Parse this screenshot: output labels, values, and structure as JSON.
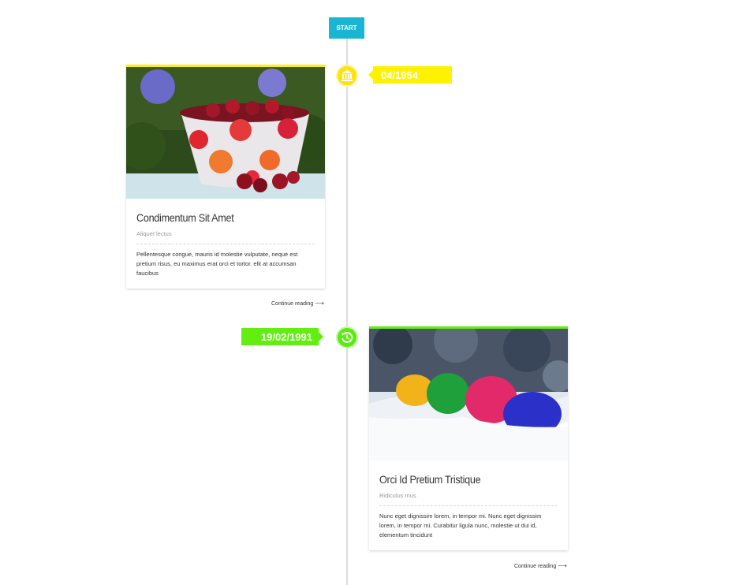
{
  "timeline": {
    "start_label": "START",
    "colors": {
      "line": "#dcdcdc",
      "start": "#19b5d2"
    }
  },
  "entries": [
    {
      "date": "04/1954",
      "accent": "#fff200",
      "icon": "bank-icon",
      "image": "cherries-bowl-photo",
      "title": "Condimentum Sit Amet",
      "subtitle": "Aliquet lectus",
      "text": "Pellentesque congue, mauris id molestie vulputate, neque est pretium risus, eu maximus erat orci et tortor. elit at accumsan faucibus",
      "continue_label": "Continue reading"
    },
    {
      "date": "19/02/1991",
      "accent": "#62ee11",
      "icon": "history-icon",
      "image": "easter-eggs-snow-photo",
      "title": "Orci Id Pretium Tristique",
      "subtitle": "Ridiculus mus",
      "text": "Nunc eget dignissim lorem, in tempor mi. Nunc eget dignissim lorem, in tempor mi. Curabitur ligula nunc, molestie ut dui id, elementum tincidunt",
      "continue_label": "Continue reading"
    }
  ]
}
